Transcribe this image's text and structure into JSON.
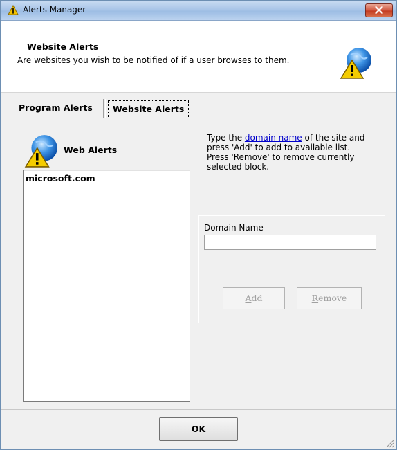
{
  "window": {
    "title": "Alerts Manager"
  },
  "header": {
    "title": "Website Alerts",
    "description": "Are websites you wish to be notified of if a user browses to them."
  },
  "tabs": [
    {
      "label": "Program Alerts",
      "selected": false
    },
    {
      "label": "Website Alerts",
      "selected": true
    }
  ],
  "web_alerts": {
    "label": "Web Alerts",
    "items": [
      "microsoft.com"
    ]
  },
  "help": {
    "line1_prefix": "Type the ",
    "line1_link": "domain name",
    "line1_suffix": " of the site and press 'Add' to add to available list.",
    "line2": "Press 'Remove' to remove currently selected block."
  },
  "form": {
    "domain_label": "Domain Name",
    "domain_value": "",
    "add_label": "Add",
    "add_accel": "A",
    "add_rest": "dd",
    "remove_label": "Remove",
    "remove_accel": "R",
    "remove_rest": "emove",
    "add_enabled": false,
    "remove_enabled": false
  },
  "footer": {
    "ok_label": "OK",
    "ok_accel": "O",
    "ok_rest": "K"
  },
  "icons": {
    "title": "warning-icon",
    "header": "globe-warning-icon",
    "web_alerts": "globe-warning-icon",
    "close": "close-icon",
    "grip": "resize-grip-icon"
  },
  "colors": {
    "link": "#0000cc",
    "titlebar": "#a9c5e8",
    "close": "#c33b21"
  }
}
